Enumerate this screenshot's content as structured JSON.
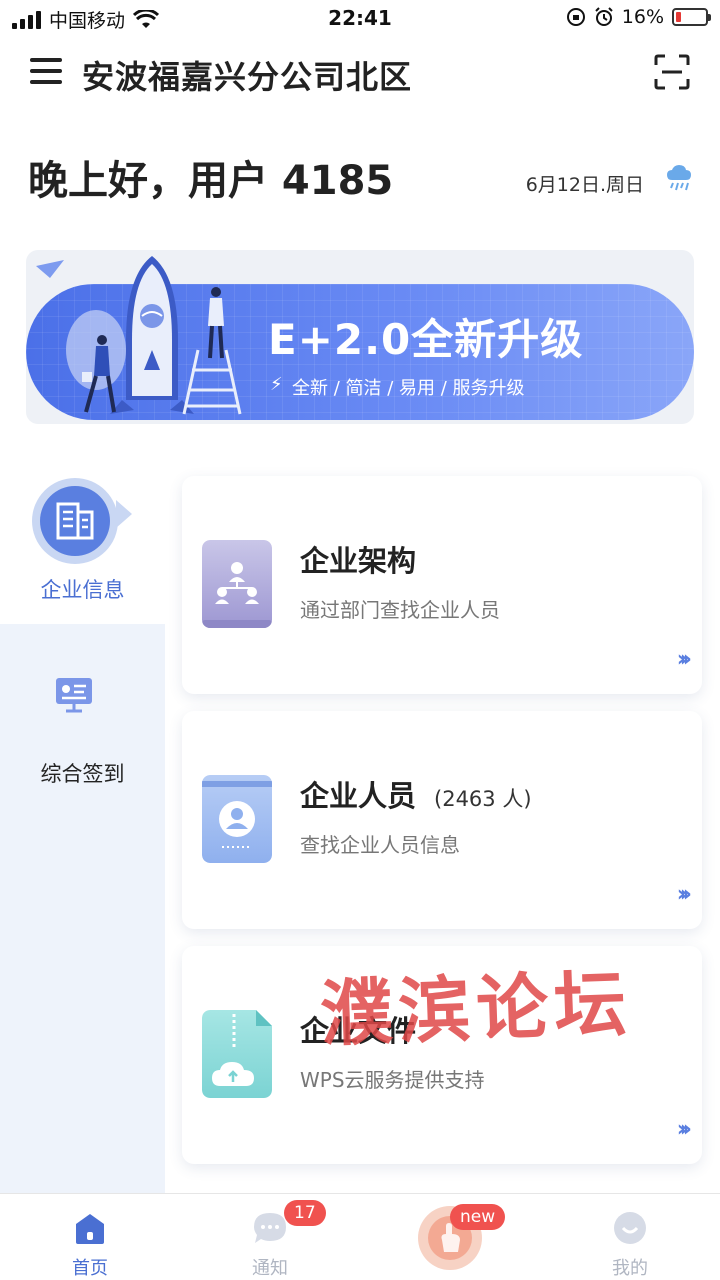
{
  "status_bar": {
    "carrier": "中国移动",
    "time": "22:41",
    "battery": "16%",
    "icons": [
      "signal-icon",
      "wifi-icon",
      "rotation-lock-icon",
      "alarm-icon",
      "battery-icon"
    ]
  },
  "header": {
    "title": "安波福嘉兴分公司北区",
    "menu_icon": "hamburger-menu-icon",
    "scan_icon": "scan-icon"
  },
  "greeting": {
    "text": "晚上好，用户 4185",
    "date": "6月12日.周日",
    "weather_icon": "rain-cloud-icon"
  },
  "banner": {
    "title": "E+2.0全新升级",
    "subtitle": "全新 / 简洁 / 易用 / 服务升级"
  },
  "sidebar": {
    "items": [
      {
        "label": "企业信息",
        "icon": "building-icon",
        "active": true
      },
      {
        "label": "综合签到",
        "icon": "checkin-screen-icon",
        "active": false
      }
    ]
  },
  "cards": [
    {
      "title": "企业架构",
      "count": "",
      "desc": "通过部门查找企业人员",
      "icon": "org-chart-icon",
      "arrow": "›››"
    },
    {
      "title": "企业人员",
      "count": "(2463 人)",
      "desc": "查找企业人员信息",
      "icon": "person-badge-icon",
      "arrow": "›››"
    },
    {
      "title": "企业文件",
      "count": "",
      "desc": "WPS云服务提供支持",
      "icon": "cloud-file-icon",
      "arrow": "›››"
    }
  ],
  "watermark": "濮滨论坛",
  "bottom_nav": {
    "items": [
      {
        "label": "首页",
        "icon": "home-icon",
        "active": true
      },
      {
        "label": "通知",
        "icon": "chat-bubble-icon",
        "badge": "17"
      },
      {
        "label": "",
        "icon": "hand-fab-icon",
        "badge": "new"
      },
      {
        "label": "我的",
        "icon": "profile-smile-icon"
      }
    ]
  },
  "colors": {
    "accent": "#4a6fd2",
    "badge": "#f0524f",
    "banner_start": "#4b70e8",
    "banner_end": "#8aa6f8"
  }
}
